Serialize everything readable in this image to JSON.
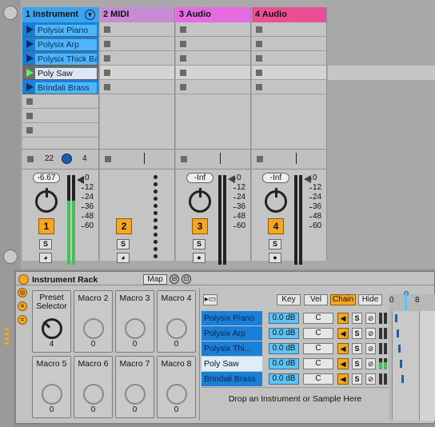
{
  "tracks": [
    {
      "name": "1 Instrument",
      "color": "#3aa4f0",
      "vol": "-6.67",
      "num": "1",
      "solo": "S",
      "status_left": "22",
      "status_right": "4"
    },
    {
      "name": "2 MIDI",
      "color": "#c78bd6",
      "num": "2",
      "solo": "S"
    },
    {
      "name": "3 Audio",
      "color": "#e76be0",
      "vol": "-Inf",
      "num": "3",
      "solo": "S"
    },
    {
      "name": "4 Audio",
      "color": "#ea4f96",
      "vol": "-Inf",
      "num": "4",
      "solo": "S"
    }
  ],
  "clips": [
    "Polysix Piano",
    "Polysix Arp",
    "Polysix Thick Bass",
    "Poly Saw",
    "Brindali Brass"
  ],
  "meter_scale": [
    "0",
    "12",
    "24",
    "36",
    "48",
    "60"
  ],
  "rack": {
    "title": "Instrument Rack",
    "map_label": "Map",
    "macros": [
      {
        "name": "Preset Selector",
        "value": "4"
      },
      {
        "name": "Macro 2",
        "value": "0"
      },
      {
        "name": "Macro 3",
        "value": "0"
      },
      {
        "name": "Macro 4",
        "value": "0"
      },
      {
        "name": "Macro 5",
        "value": "0"
      },
      {
        "name": "Macro 6",
        "value": "0"
      },
      {
        "name": "Macro 7",
        "value": "0"
      },
      {
        "name": "Macro 8",
        "value": "0"
      }
    ],
    "buttons": {
      "key": "Key",
      "vel": "Vel",
      "chain": "Chain",
      "hide": "Hide"
    },
    "chains": [
      {
        "name": "Polysix Piano",
        "db": "0.0 dB",
        "pan": "C",
        "solo": "S"
      },
      {
        "name": "Polysix Arp",
        "db": "0.0 dB",
        "pan": "C",
        "solo": "S"
      },
      {
        "name": "Polysix Thi...",
        "db": "0.0 dB",
        "pan": "C",
        "solo": "S"
      },
      {
        "name": "Poly Saw",
        "db": "0.0 dB",
        "pan": "C",
        "solo": "S"
      },
      {
        "name": "Brindali Brass",
        "db": "0.0 dB",
        "pan": "C",
        "solo": "S"
      }
    ],
    "drop_text": "Drop an Instrument or Sample Here",
    "zone_ruler": [
      "0",
      "8"
    ]
  }
}
